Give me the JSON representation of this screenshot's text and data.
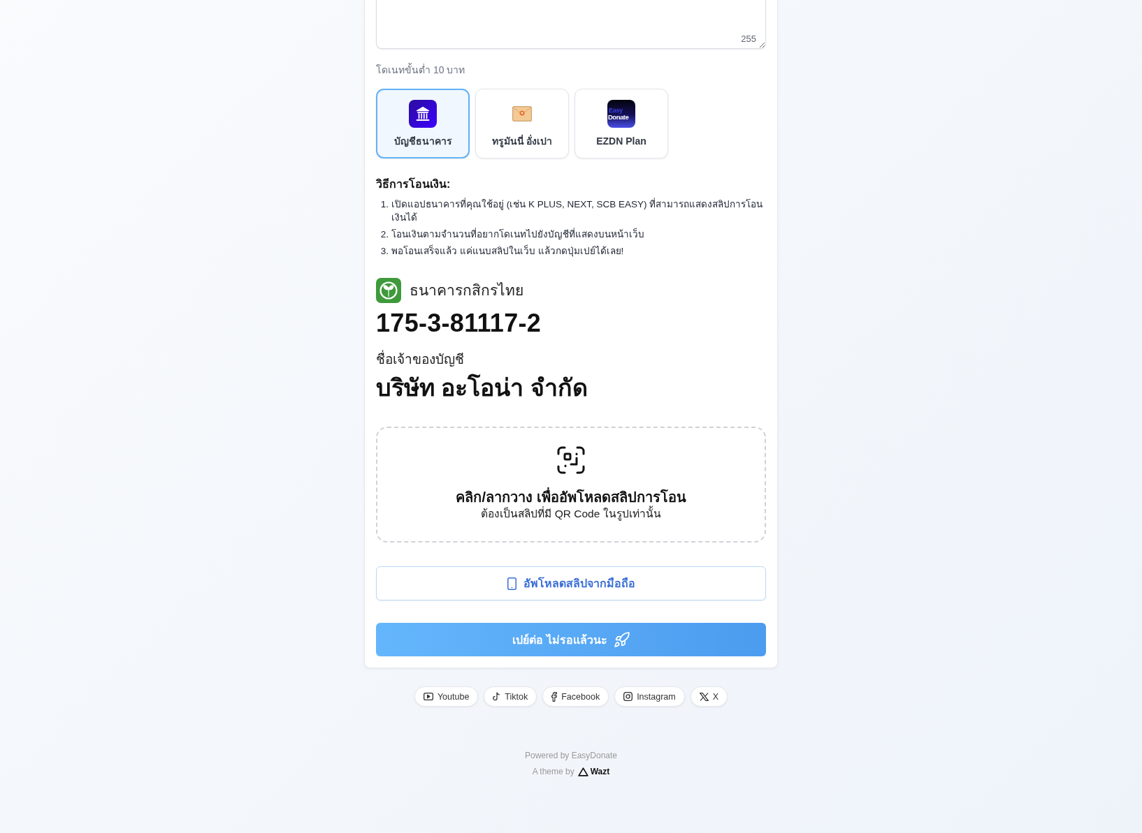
{
  "message_box": {
    "counter": "255"
  },
  "minimum_note": "โดเนทขั้นต่ำ 10 บาท",
  "payment_methods": [
    {
      "kind": "bank",
      "label": "บัญชีธนาคาร",
      "selected": true
    },
    {
      "kind": "envelope",
      "label": "ทรูมันนี่ อั่งเปา",
      "selected": false
    },
    {
      "kind": "plan",
      "label": "EZDN Plan",
      "selected": false,
      "logo_text": [
        "Easy",
        "Donate"
      ]
    }
  ],
  "instructions": {
    "title": "วิธีการโอนเงิน:",
    "steps": [
      {
        "number": "1.",
        "text": "เปิดแอปธนาคารที่คุณใช้อยู่ (เช่น K PLUS, NEXT, SCB EASY) ที่สามารถแสดงสลิปการโอนเงินได้"
      },
      {
        "number": "2.",
        "text": "โอนเงินตามจำนวนที่อยากโดเนทไปยังบัญชีที่แสดงบนหน้าเว็บ"
      },
      {
        "number": "3.",
        "text": "พอโอนเสร็จแล้ว แค่แนบสลิปในเว็บ แล้วกดปุ่มเปย์ได้เลย!"
      }
    ]
  },
  "bank": {
    "name": "ธนาคารกสิกรไทย",
    "account_number": "175-3-81117-2",
    "owner_label": "ชื่อเจ้าของบัญชี",
    "owner_name": "บริษัท อะโอน่า จำกัด"
  },
  "upload": {
    "title": "คลิก/ลากวาง เพื่ออัพโหลดสลิปการโอน",
    "hint": "ต้องเป็นสลิปที่มี QR Code ในรูปเท่านั้น"
  },
  "mobile_upload_button": "อัพโหลดสลิปจากมือถือ",
  "pay_button": "เปย์ต่อ ไม่รอแล้วนะ",
  "social_links": [
    {
      "kind": "youtube",
      "label": "Youtube"
    },
    {
      "kind": "tiktok",
      "label": "Tiktok"
    },
    {
      "kind": "facebook",
      "label": "Facebook"
    },
    {
      "kind": "instagram",
      "label": "Instagram"
    },
    {
      "kind": "x",
      "label": "X"
    }
  ],
  "footer": {
    "powered_by": "Powered by EasyDonate",
    "theme_prefix": "A theme by",
    "theme_author": "Wazt"
  }
}
